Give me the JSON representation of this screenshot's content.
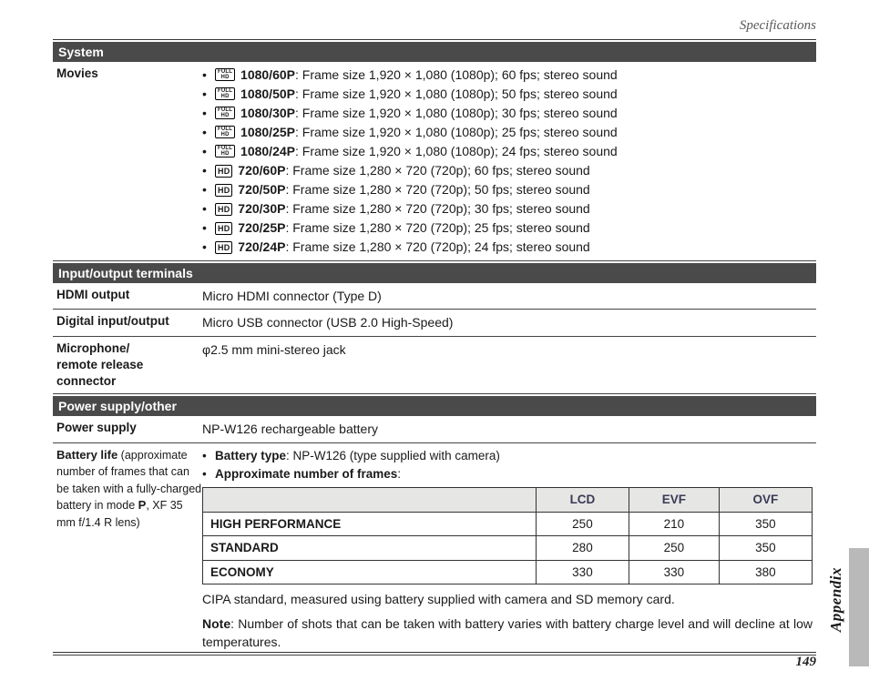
{
  "header": {
    "section_label": "Specifications"
  },
  "sections": {
    "system": {
      "title": "System",
      "movies_label": "Movies",
      "movies": [
        {
          "icon": "fhd",
          "name": "1080/60P",
          "desc": ": Frame size 1,920 × 1,080 (1080p); 60 fps; stereo sound"
        },
        {
          "icon": "fhd",
          "name": "1080/50P",
          "desc": ": Frame size 1,920 × 1,080 (1080p); 50 fps; stereo sound"
        },
        {
          "icon": "fhd",
          "name": "1080/30P",
          "desc": ": Frame size 1,920 × 1,080 (1080p); 30 fps; stereo sound"
        },
        {
          "icon": "fhd",
          "name": "1080/25P",
          "desc": ": Frame size 1,920 × 1,080 (1080p); 25 fps; stereo sound"
        },
        {
          "icon": "fhd",
          "name": "1080/24P",
          "desc": ": Frame size 1,920 × 1,080 (1080p); 24 fps; stereo sound"
        },
        {
          "icon": "hd",
          "name": "720/60P",
          "desc": ": Frame size 1,280 × 720 (720p); 60 fps; stereo sound"
        },
        {
          "icon": "hd",
          "name": "720/50P",
          "desc": ": Frame size 1,280 × 720 (720p); 50 fps; stereo sound"
        },
        {
          "icon": "hd",
          "name": "720/30P",
          "desc": ": Frame size 1,280 × 720 (720p); 30 fps; stereo sound"
        },
        {
          "icon": "hd",
          "name": "720/25P",
          "desc": ": Frame size 1,280 × 720 (720p); 25 fps; stereo sound"
        },
        {
          "icon": "hd",
          "name": "720/24P",
          "desc": ": Frame size 1,280 × 720 (720p); 24 fps; stereo sound"
        }
      ]
    },
    "io": {
      "title": "Input/output terminals",
      "rows": [
        {
          "label": "HDMI output",
          "value": "Micro HDMI connector (Type D)"
        },
        {
          "label": "Digital input/output",
          "value": "Micro USB connector (USB 2.0 High-Speed)"
        },
        {
          "label_main": "Microphone/",
          "label_sub": "remote release connector",
          "value": "φ2.5 mm mini-stereo jack"
        }
      ]
    },
    "power": {
      "title": "Power supply/other",
      "supply_label": "Power supply",
      "supply_value": "NP-W126 rechargeable battery",
      "battery_life_label_main": "Battery life",
      "battery_life_label_sub1": " (approximate number of frames that can be taken with a fully-charged battery in mode ",
      "battery_life_label_mode": "P",
      "battery_life_label_sub2": ", XF 35 mm f/1.4 R lens)",
      "battery_type_bold": "Battery type",
      "battery_type_rest": ": NP-W126 (type supplied with camera)",
      "approx_frames_bold": "Approximate number of frames",
      "approx_frames_rest": ":",
      "table": {
        "headers": [
          "",
          "LCD",
          "EVF",
          "OVF"
        ],
        "rows": [
          {
            "mode": "HIGH PERFORMANCE",
            "lcd": "250",
            "evf": "210",
            "ovf": "350"
          },
          {
            "mode": "STANDARD",
            "lcd": "280",
            "evf": "250",
            "ovf": "350"
          },
          {
            "mode": "ECONOMY",
            "lcd": "330",
            "evf": "330",
            "ovf": "380"
          }
        ]
      },
      "cipa_note": "CIPA standard, measured using battery supplied with camera and SD memory card.",
      "note_bold": "Note",
      "note_rest": ": Number of shots that can be taken with battery varies with battery charge level and will decline at low temperatures."
    }
  },
  "side": {
    "appendix": "Appendix"
  },
  "page_number": "149",
  "chart_data": {
    "type": "table",
    "title": "Approximate number of frames",
    "columns": [
      "LCD",
      "EVF",
      "OVF"
    ],
    "rows": [
      "HIGH PERFORMANCE",
      "STANDARD",
      "ECONOMY"
    ],
    "values": [
      [
        250,
        210,
        350
      ],
      [
        280,
        250,
        350
      ],
      [
        330,
        330,
        380
      ]
    ]
  }
}
